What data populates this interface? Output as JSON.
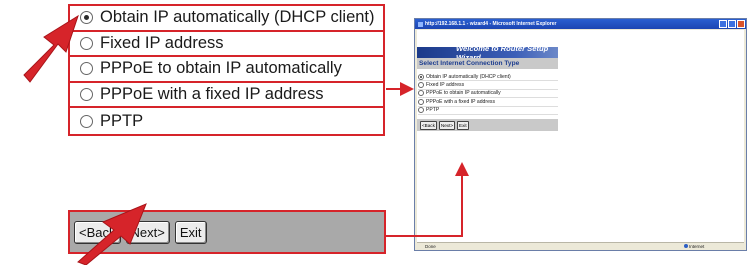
{
  "options": [
    {
      "label": "Obtain IP automatically (DHCP client)",
      "selected": true
    },
    {
      "label": "Fixed IP address",
      "selected": false
    },
    {
      "label": "PPPoE to obtain IP automatically",
      "selected": false
    },
    {
      "label": "PPPoE with a fixed IP address",
      "selected": false
    },
    {
      "label": "PPTP",
      "selected": false
    }
  ],
  "buttons": {
    "back": "<Back",
    "next": "Next>",
    "exit": "Exit"
  },
  "browser": {
    "title": "http://192.168.1.1 - wizard4 - Microsoft Internet Explorer",
    "status_left": "Done",
    "status_zone": "Internet"
  },
  "wizard": {
    "banner": "Welcome to Router Setup Wizard",
    "heading": "Select Internet Connection Type"
  },
  "colors": {
    "highlight": "#d6242a",
    "banner": "#1c3a8a",
    "heading_text": "#1d3d8f"
  }
}
